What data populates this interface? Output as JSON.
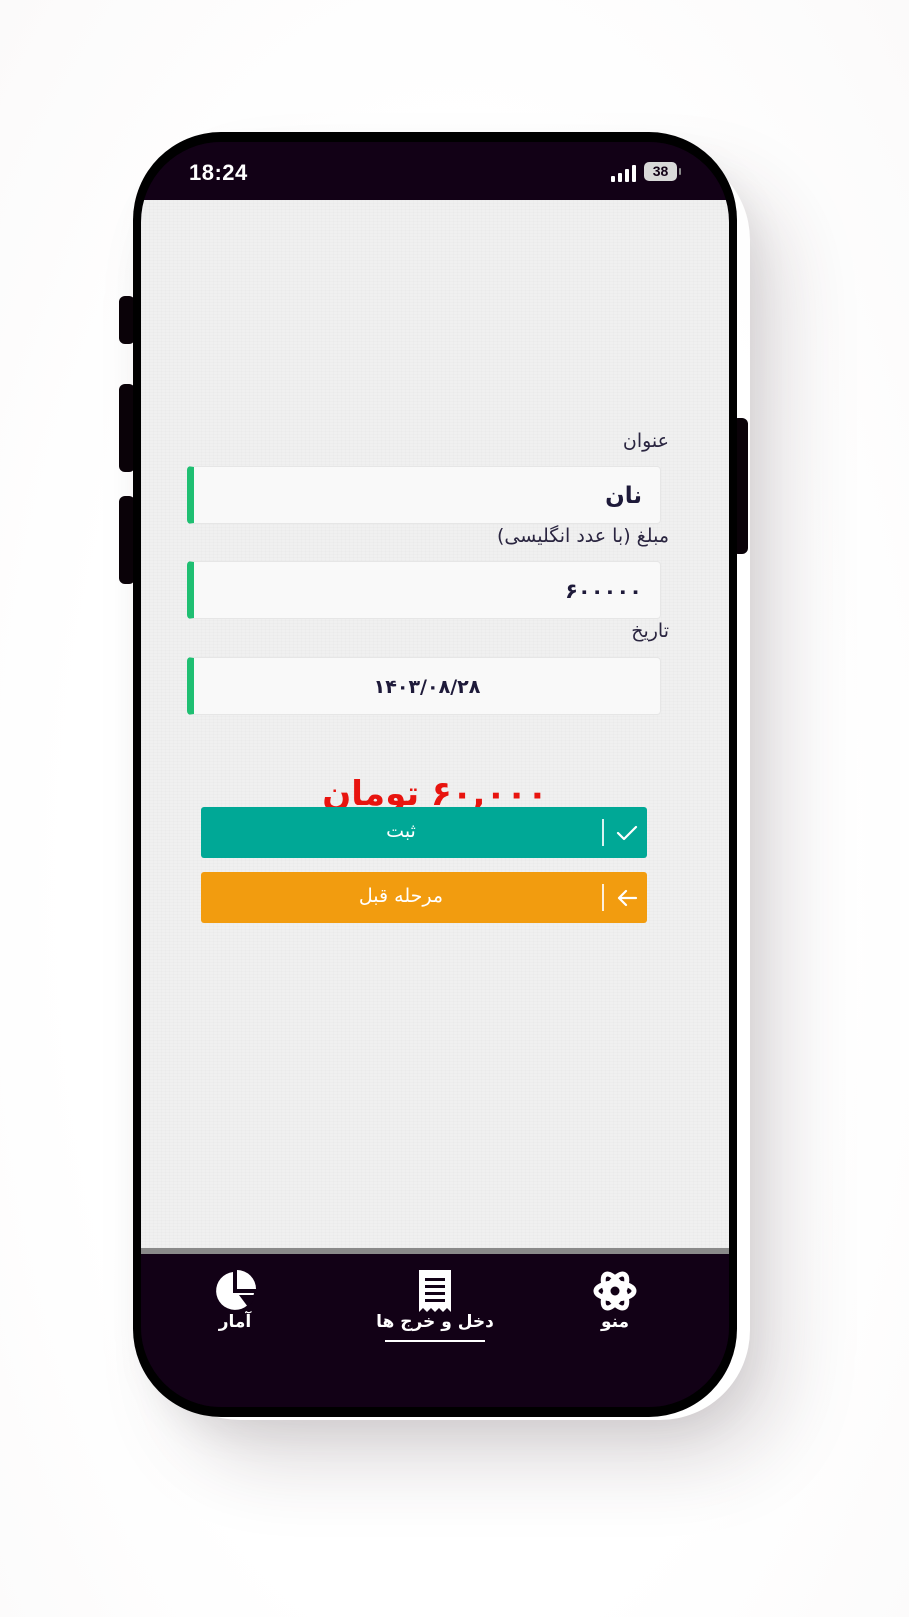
{
  "status_bar": {
    "time": "18:24",
    "battery": "38"
  },
  "form": {
    "title_label": "عنوان",
    "title_value": "نان",
    "amount_label": "مبلغ (با عدد انگلیسی)",
    "amount_value": "۶۰۰۰۰۰",
    "date_label": "تاریخ",
    "date_value": "۱۴۰۳/۰۸/۲۸"
  },
  "amount_display": "۶۰,۰۰۰ تومان",
  "buttons": {
    "submit_label": "ثبت",
    "back_label": "مرحله قبل"
  },
  "bottom_nav": {
    "items": [
      {
        "label": "آمار",
        "icon": "pie-chart-icon"
      },
      {
        "label": "دخل و خرج ها",
        "icon": "receipt-icon",
        "active": true
      },
      {
        "label": "منو",
        "icon": "gear-icon"
      }
    ]
  },
  "colors": {
    "accent_green": "#1fbf72",
    "submit_teal": "#00a896",
    "back_orange": "#f29c0f",
    "amount_red": "#e8140f",
    "nav_bg": "#120116"
  }
}
